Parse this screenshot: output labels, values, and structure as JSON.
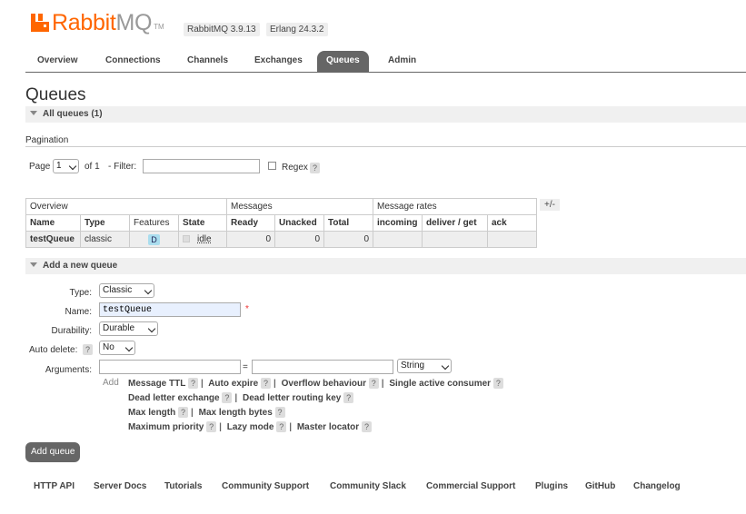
{
  "app": {
    "logo_text_1": "Rabbit",
    "logo_text_2": "MQ",
    "logo_tm": "TM",
    "version": "RabbitMQ 3.9.13",
    "erlang": "Erlang 24.3.2"
  },
  "nav": {
    "tabs": [
      {
        "label": "Overview",
        "active": false
      },
      {
        "label": "Connections",
        "active": false
      },
      {
        "label": "Channels",
        "active": false
      },
      {
        "label": "Exchanges",
        "active": false
      },
      {
        "label": "Queues",
        "active": true
      },
      {
        "label": "Admin",
        "active": false
      }
    ]
  },
  "page": {
    "title": "Queues",
    "all_queues_header": "All queues (1)"
  },
  "pagination": {
    "label": "Pagination",
    "page_label": "Page",
    "page_value": "1",
    "of_label": "of 1",
    "filter_label": "- Filter:",
    "filter_value": "",
    "regex_label": "Regex",
    "help": "?"
  },
  "table": {
    "toggle": "+/-",
    "groups": [
      "Overview",
      "Messages",
      "Message rates"
    ],
    "columns": [
      "Name",
      "Type",
      "Features",
      "State",
      "Ready",
      "Unacked",
      "Total",
      "incoming",
      "deliver / get",
      "ack"
    ],
    "rows": [
      {
        "name": "testQueue",
        "type": "classic",
        "feature": "D",
        "state": "idle",
        "ready": "0",
        "unacked": "0",
        "total": "0",
        "incoming": "",
        "deliver_get": "",
        "ack": ""
      }
    ]
  },
  "add_queue": {
    "header": "Add a new queue",
    "type_label": "Type:",
    "type_value": "Classic",
    "name_label": "Name:",
    "name_value": "testQueue",
    "required_mark": "*",
    "durability_label": "Durability:",
    "durability_value": "Durable",
    "auto_delete_label": "Auto delete:",
    "auto_delete_value": "No",
    "arguments_label": "Arguments:",
    "equals": "=",
    "arg_type_value": "String",
    "add_label": "Add",
    "arg_links": [
      [
        "Message TTL",
        "Auto expire",
        "Overflow behaviour",
        "Single active consumer"
      ],
      [
        "Dead letter exchange",
        "Dead letter routing key"
      ],
      [
        "Max length",
        "Max length bytes"
      ],
      [
        "Maximum priority",
        "Lazy mode",
        "Master locator"
      ]
    ],
    "submit_label": "Add queue"
  },
  "footer": {
    "links": [
      "HTTP API",
      "Server Docs",
      "Tutorials",
      "Community Support",
      "Community Slack",
      "Commercial Support",
      "Plugins",
      "GitHub",
      "Changelog"
    ]
  },
  "colors": {
    "brand": "#ff6600",
    "tab_active": "#666666",
    "feature_badge": "#aaddee"
  }
}
